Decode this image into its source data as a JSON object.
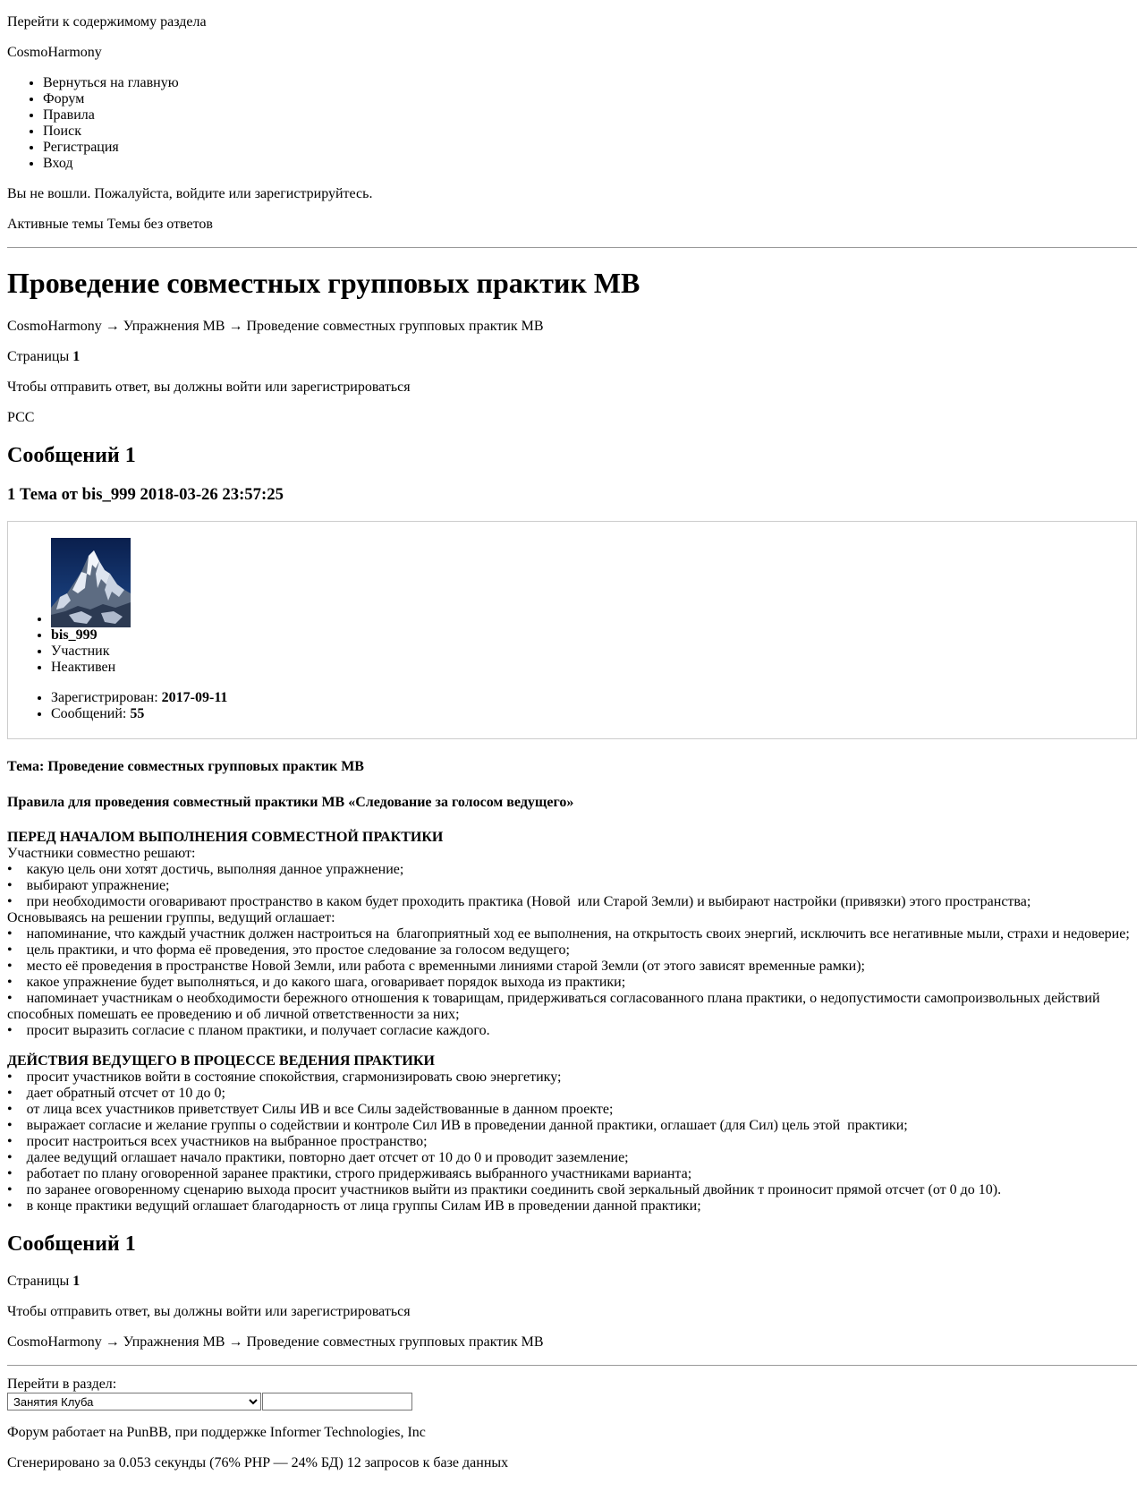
{
  "header": {
    "skip_link": "Перейти к содержимому раздела",
    "site_title": "CosmoHarmony",
    "nav": [
      "Вернуться на главную",
      "Форум",
      "Правила",
      "Поиск",
      "Регистрация",
      "Вход"
    ],
    "login_notice": "Вы не вошли. Пожалуйста, войдите или зарегистрируйтесь.",
    "quick_links": [
      "Активные темы",
      "Темы без ответов"
    ]
  },
  "topic": {
    "title": "Проведение совместных групповых практик МВ",
    "breadcrumb": [
      "CosmoHarmony",
      "Упражнения МВ",
      "Проведение совместных групповых практик МВ"
    ],
    "breadcrumb_sep": "→",
    "pages_label": "Страницы",
    "pages_current": "1",
    "reply_notice": "Чтобы отправить ответ, вы должны войти или зарегистрироваться",
    "rss": "РСС",
    "posts_heading": "Сообщений 1"
  },
  "post": {
    "header": "1 Тема от bis_999 2018-03-26 23:57:25",
    "author": {
      "name": "bis_999",
      "title": "Участник",
      "status": "Неактивен",
      "registered_label": "Зарегистрирован:",
      "registered_value": "2017-09-11",
      "posts_label": "Сообщений:",
      "posts_value": "55"
    },
    "subject": "Тема: Проведение совместных групповых практик МВ",
    "rules_title": "Правила для проведения совместный практики МВ «Следование за голосом ведущего»",
    "section1_title": "ПЕРЕД НАЧАЛОМ ВЫПОЛНЕНИЯ СОВМЕСТНОЙ ПРАКТИКИ",
    "section1_lines": [
      "Участники совместно решают:",
      "•    какую цель они хотят достичь, выполняя данное упражнение;",
      "•    выбирают упражнение;",
      "•    при необходимости оговаривают пространство в каком будет проходить практика (Новой  или Старой Земли) и выбирают настройки (привязки) этого пространства;",
      "Основываясь на решении группы, ведущий оглашает:",
      "•    напоминание, что каждый участник должен настроиться на  благоприятный ход ее выполнения, на открытость своих энергий, исключить все негативные мыли, страхи и недоверие;",
      "•    цель практики, и что форма её проведения, это простое следование за голосом ведущего;",
      "•    место её проведения в пространстве Новой Земли, или работа с временными линиями старой Земли (от этого зависят временные рамки);",
      "•    какое упражнение будет выполняться, и до какого шага, оговаривает порядок выхода из практики;",
      "•    напоминает участникам о необходимости бережного отношения к товарищам, придерживаться согласованного плана практики, о недопустимости самопроизвольных действий способных помешать ее проведению и об личной ответственности за них;",
      "•    просит выразить согласие с планом практики, и получает согласие каждого."
    ],
    "section2_title": "ДЕЙСТВИЯ ВЕДУЩЕГО В ПРОЦЕССЕ ВЕДЕНИЯ ПРАКТИКИ",
    "section2_lines": [
      "•    просит участников войти в состояние спокойствия, сгармонизировать свою энергетику;",
      "•    дает обратный отсчет от 10 до 0;",
      "•    от лица всех участников приветствует Силы ИВ и все Силы задействованные в данном проекте;",
      "•    выражает согласие и желание группы о содействии и контроле Сил ИВ в проведении данной практики, оглашает (для Сил) цель этой  практики;",
      "•    просит настроиться всех участников на выбранное пространство;",
      "•    далее ведущий оглашает начало практики, повторно дает отсчет от 10 до 0 и проводит заземление;",
      "•    работает по плану оговоренной заранее практики, строго придерживаясь выбранного участниками варианта;",
      "•    по заранее оговоренному сценарию выхода просит участников выйти из практики соединить свой зеркальный двойник т проиносит прямой отсчет (от 0 до 10).",
      "•    в конце практики ведущий оглашает благодарность от лица группы Силам ИВ в проведении данной практики;"
    ]
  },
  "footer": {
    "posts_heading": "Сообщений 1",
    "pages_label": "Страницы",
    "pages_current": "1",
    "reply_notice": "Чтобы отправить ответ, вы должны войти или зарегистрироваться",
    "jump_label": "Перейти в раздел:",
    "jump_selected": "Занятия Клуба",
    "powered": "Форум работает на PunBB, при поддержке Informer Technologies, Inc",
    "generated": "Сгенерировано за 0.053 секунды (76% PHP — 24% БД) 12 запросов к базе данных"
  },
  "colors": {
    "text": "#000000",
    "background": "#ffffff",
    "rule": "#999999",
    "box_border": "#cccccc"
  },
  "icons": {
    "avatar": "mountain-photo-avatar"
  }
}
